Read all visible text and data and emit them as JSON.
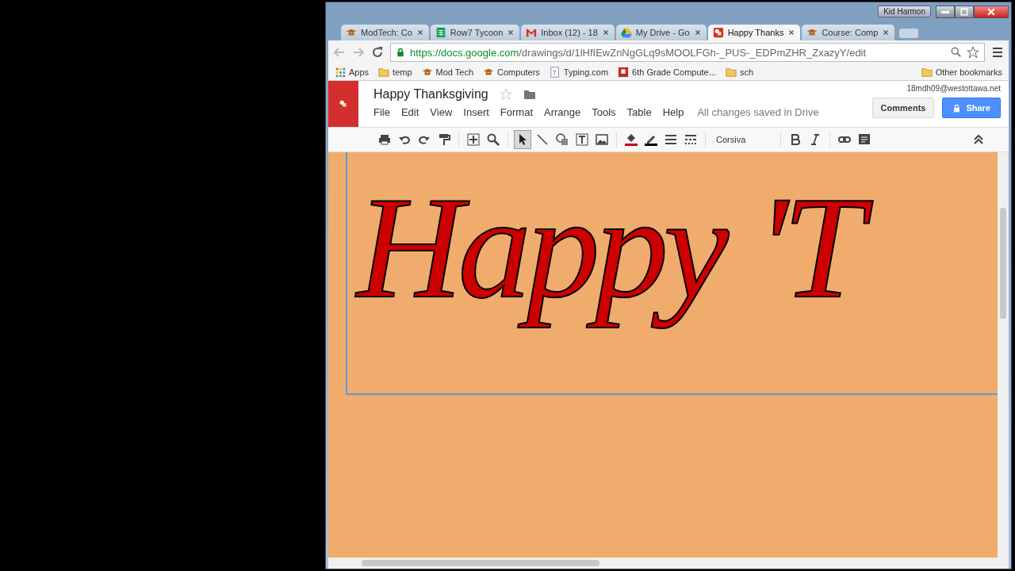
{
  "window": {
    "user": "Kid Harmon"
  },
  "tabs": [
    {
      "title": "ModTech: Co",
      "kind": "hat",
      "selected": false
    },
    {
      "title": "Row7 Tycoon",
      "kind": "sheet",
      "selected": false
    },
    {
      "title": "Inbox (12) - 18",
      "kind": "mail",
      "selected": false
    },
    {
      "title": "My Drive - Go",
      "kind": "drive",
      "selected": false
    },
    {
      "title": "Happy Thanks",
      "kind": "drawing",
      "selected": true
    },
    {
      "title": "Course: Comp",
      "kind": "hat",
      "selected": false
    }
  ],
  "address_bar": {
    "host": "https://docs.google.com",
    "path": "/drawings/d/1lHfIEwZnNgGLq9sMOOLFGh-_PUS-_EDPmZHR_ZxazyY/edit"
  },
  "bookmarks": [
    {
      "label": "Apps",
      "kind": "apps"
    },
    {
      "label": "temp",
      "kind": "folder"
    },
    {
      "label": "Mod Tech",
      "kind": "hat"
    },
    {
      "label": "Computers",
      "kind": "hat"
    },
    {
      "label": "Typing.com",
      "kind": "page"
    },
    {
      "label": "6th Grade Compute...",
      "kind": "red"
    },
    {
      "label": "sch",
      "kind": "folder"
    }
  ],
  "other_bookmarks": "Other bookmarks",
  "document": {
    "title": "Happy Thanksgiving",
    "account": "18mdh09@westottawa.net",
    "save_status": "All changes saved in Drive",
    "comments_button": "Comments",
    "share_button": "Share"
  },
  "menu": [
    "File",
    "Edit",
    "View",
    "Insert",
    "Format",
    "Arrange",
    "Tools",
    "Table",
    "Help"
  ],
  "tools": [
    {
      "kind": "print",
      "selected": false
    },
    {
      "kind": "undo",
      "selected": false
    },
    {
      "kind": "redo",
      "selected": false
    },
    {
      "kind": "paint",
      "selected": false
    },
    {
      "kind": "sep"
    },
    {
      "kind": "fit",
      "selected": false
    },
    {
      "kind": "zoom",
      "selected": false
    },
    {
      "kind": "sep"
    },
    {
      "kind": "select",
      "selected": true
    },
    {
      "kind": "line",
      "selected": false
    },
    {
      "kind": "shape",
      "selected": false
    },
    {
      "kind": "textbox",
      "selected": false
    },
    {
      "kind": "image",
      "selected": false
    },
    {
      "kind": "sep"
    },
    {
      "kind": "fill",
      "selected": false
    },
    {
      "kind": "pen",
      "selected": false
    },
    {
      "kind": "weight",
      "selected": false
    },
    {
      "kind": "dash",
      "selected": false
    },
    {
      "kind": "sep"
    },
    {
      "kind": "font"
    },
    {
      "kind": "sep"
    },
    {
      "kind": "bold",
      "selected": false
    },
    {
      "kind": "italic",
      "selected": false
    },
    {
      "kind": "sep"
    },
    {
      "kind": "link",
      "selected": false
    },
    {
      "kind": "comment",
      "selected": false
    }
  ],
  "font_name": "Corsiva",
  "canvas": {
    "text": "Happy 'T"
  }
}
